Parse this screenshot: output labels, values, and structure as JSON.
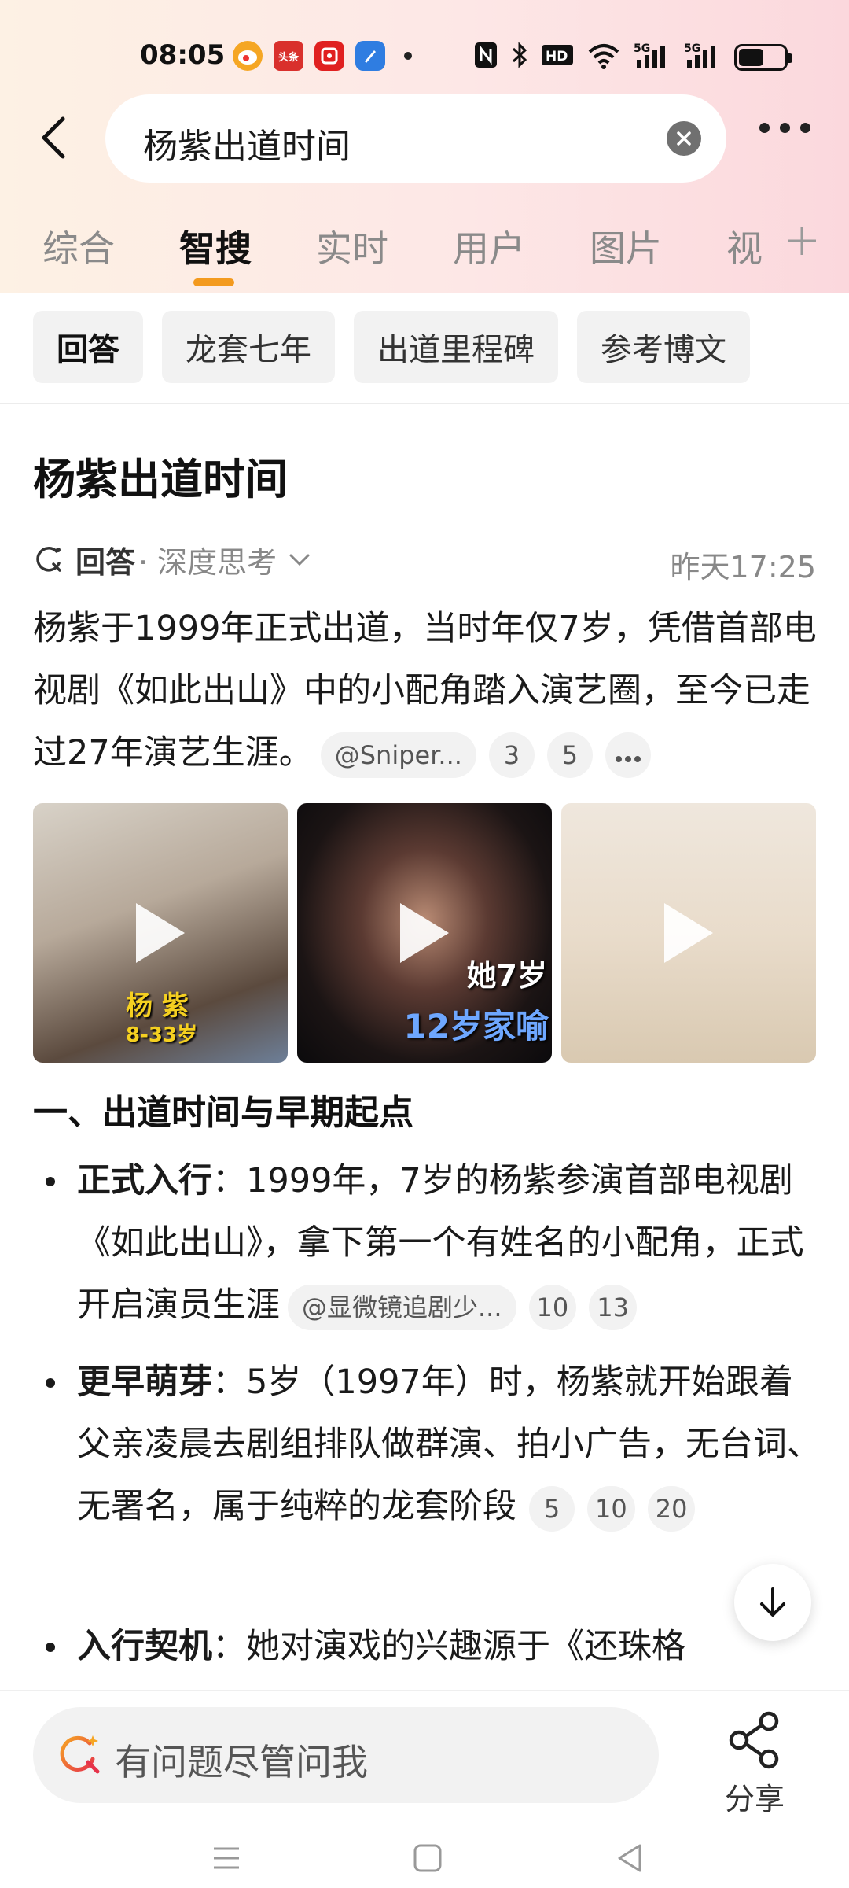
{
  "status_bar": {
    "time": "08:05",
    "notification_icons": [
      "weibo-icon",
      "toutiao-icon",
      "pinduoduo-icon",
      "blue-app-icon"
    ],
    "network": "5G",
    "network2": "5G",
    "hd": "HD"
  },
  "header": {
    "query": "杨紫出道时间"
  },
  "tabs": [
    {
      "label": "综合"
    },
    {
      "label": "智搜"
    },
    {
      "label": "实时"
    },
    {
      "label": "用户"
    },
    {
      "label": "图片"
    },
    {
      "label": "视"
    }
  ],
  "active_tab": "智搜",
  "chips": [
    {
      "label": "回答"
    },
    {
      "label": "龙套七年"
    },
    {
      "label": "出道里程碑"
    },
    {
      "label": "参考博文"
    }
  ],
  "answer": {
    "title": "杨紫出道时间",
    "meta_label": "回答",
    "meta_sub": "· 深度思考",
    "timestamp": "昨天17:25",
    "summary": "杨紫于1999年正式出道，当时年仅7岁，凭借首部电视剧《如此出山》中的小配角踏入演艺圈，至今已走过27年演艺生涯。",
    "summary_cite": "@Sniper...",
    "summary_refs": [
      "3",
      "5"
    ],
    "media": [
      {
        "caption": "杨 紫",
        "caption2": "8-33岁"
      },
      {
        "caption": "她7岁",
        "caption2": "12岁家喻"
      },
      {
        "caption": "",
        "caption2": ""
      }
    ],
    "section_heading": "一、出道时间与早期起点",
    "bullets": [
      {
        "term": "正式入行",
        "text": "：1999年，7岁的杨紫参演首部电视剧《如此出山》，拿下第一个有姓名的小配角，正式开启演员生涯",
        "cite": "@显微镜追剧少...",
        "refs": [
          "10",
          "13"
        ]
      },
      {
        "term": "更早萌芽",
        "text": "：5岁（1997年）时，杨紫就开始跟着父亲凌晨去剧组排队做群演、拍小广告，无台词、无署名，属于纯粹的龙套阶段",
        "refs": [
          "5",
          "10",
          "20"
        ]
      },
      {
        "term": "入行契机",
        "text": "：她对演戏的兴趣源于《还珠格"
      }
    ]
  },
  "bottom": {
    "ask_placeholder": "有问题尽管问我",
    "share_label": "分享"
  },
  "colors": {
    "accent": "#f39a1e",
    "header_gradient_start": "#fdf1e4",
    "header_gradient_end": "#fbd8dd",
    "chip_bg": "#f2f2f2"
  }
}
